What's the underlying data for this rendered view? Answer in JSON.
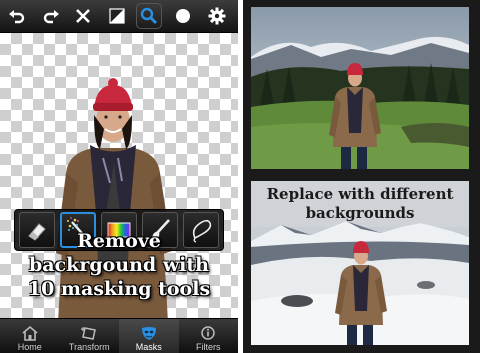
{
  "toolbar": {
    "buttons": [
      {
        "icon": "undo-icon"
      },
      {
        "icon": "redo-icon"
      },
      {
        "icon": "close-icon"
      },
      {
        "icon": "invert-icon"
      },
      {
        "icon": "zoom-icon",
        "active": true
      },
      {
        "icon": "brush-size-icon"
      },
      {
        "icon": "gear-icon"
      }
    ]
  },
  "mask_tools": [
    {
      "icon": "eraser-icon"
    },
    {
      "icon": "magic-wand-icon",
      "selected": true
    },
    {
      "icon": "color-range-icon"
    },
    {
      "icon": "brush-icon"
    },
    {
      "icon": "lasso-icon"
    }
  ],
  "promo": {
    "left_caption": [
      "Remove",
      "backrgound with",
      "10 masking tools"
    ],
    "right_caption": [
      "Replace with different",
      "backgrounds"
    ]
  },
  "tabbar": {
    "tabs": [
      {
        "label": "Home",
        "icon": "home-icon"
      },
      {
        "label": "Transform",
        "icon": "transform-icon"
      },
      {
        "label": "Masks",
        "icon": "masks-icon",
        "active": true
      },
      {
        "label": "Filters",
        "icon": "filters-icon"
      }
    ]
  },
  "colors": {
    "accent": "#2a8fe0",
    "toolbar_bg": "#1e1e1e",
    "sky": "#b8c6d4",
    "grass": "#5f8a3a",
    "coat": "#8a6a4a",
    "hat": "#c8283c"
  }
}
